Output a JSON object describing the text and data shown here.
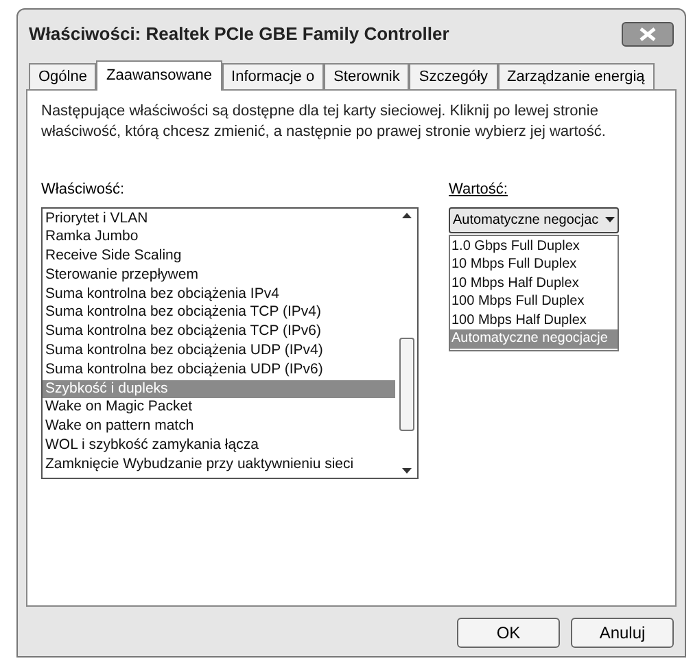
{
  "window": {
    "title": "Właściwości: Realtek PCIe GBE Family Controller"
  },
  "tabs": [
    {
      "label": "Ogólne",
      "selected": false
    },
    {
      "label": "Zaawansowane",
      "selected": true
    },
    {
      "label": "Informacje o",
      "selected": false
    },
    {
      "label": "Sterownik",
      "selected": false
    },
    {
      "label": "Szczegóły",
      "selected": false
    },
    {
      "label": "Zarządzanie energią",
      "selected": false
    }
  ],
  "description": "Następujące właściwości są dostępne dla tej karty sieciowej. Kliknij po lewej stronie właściwość, którą chcesz zmienić, a następnie po prawej stronie wybierz jej wartość.",
  "property": {
    "label": "Właściwość:",
    "items": [
      {
        "label": "Priorytet i VLAN",
        "selected": false
      },
      {
        "label": "Ramka Jumbo",
        "selected": false
      },
      {
        "label": "Receive Side Scaling",
        "selected": false
      },
      {
        "label": "Sterowanie przepływem",
        "selected": false
      },
      {
        "label": "Suma kontrolna bez obciążenia IPv4",
        "selected": false
      },
      {
        "label": "Suma kontrolna bez obciążenia TCP (IPv4)",
        "selected": false
      },
      {
        "label": "Suma kontrolna bez obciążenia TCP (IPv6)",
        "selected": false
      },
      {
        "label": "Suma kontrolna bez obciążenia UDP (IPv4)",
        "selected": false
      },
      {
        "label": "Suma kontrolna bez obciążenia UDP (IPv6)",
        "selected": false
      },
      {
        "label": "Szybkość i dupleks",
        "selected": true
      },
      {
        "label": "Wake on Magic Packet",
        "selected": false
      },
      {
        "label": "Wake on pattern match",
        "selected": false
      },
      {
        "label": "WOL i szybkość zamykania łącza",
        "selected": false
      },
      {
        "label": "Zamknięcie Wybudzanie przy uaktywnieniu sieci",
        "selected": false
      }
    ]
  },
  "value": {
    "label": "Wartość:",
    "current": "Automatyczne negocjac",
    "options": [
      {
        "label": "1.0 Gbps Full Duplex",
        "selected": false
      },
      {
        "label": "10 Mbps Full Duplex",
        "selected": false
      },
      {
        "label": "10 Mbps Half Duplex",
        "selected": false
      },
      {
        "label": "100 Mbps Full Duplex",
        "selected": false
      },
      {
        "label": "100 Mbps Half Duplex",
        "selected": false
      },
      {
        "label": "Automatyczne negocjacje",
        "selected": true
      }
    ]
  },
  "buttons": [
    "OK",
    "Anuluj"
  ]
}
